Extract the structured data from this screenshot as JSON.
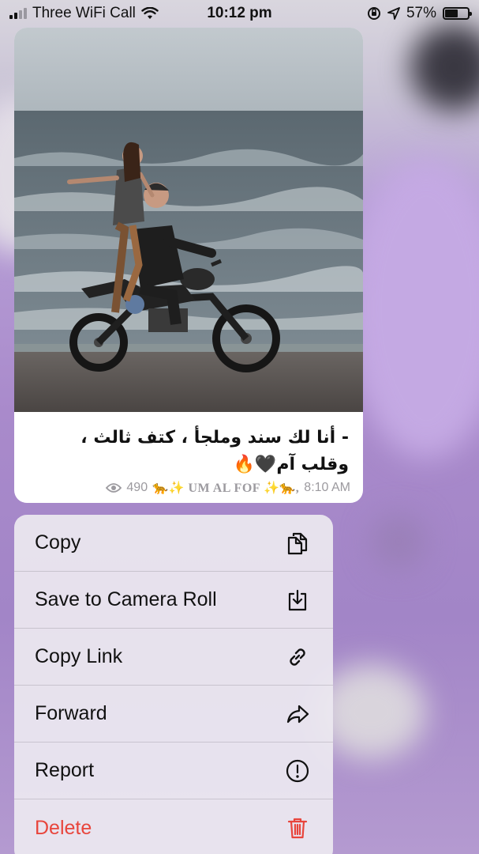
{
  "status_bar": {
    "carrier": "Three WiFi Call",
    "time": "10:12 pm",
    "battery_percent": "57%",
    "battery_level": 0.57,
    "signal_bars": 2
  },
  "message": {
    "caption_line1": "- أنا لك سند وملجأ ، كتف ثالث ،",
    "caption_line2": "وقلب آم🖤🔥",
    "views": "490",
    "channel_name": "🐆✨ UM AL FOF ✨🐆,",
    "time": "8:10 AM",
    "photo_icon": "couple-on-motorcycle-photo"
  },
  "menu": {
    "items": [
      {
        "label": "Copy",
        "icon": "copy-icon"
      },
      {
        "label": "Save to Camera Roll",
        "icon": "save-download-icon"
      },
      {
        "label": "Copy Link",
        "icon": "link-icon"
      },
      {
        "label": "Forward",
        "icon": "forward-arrow-icon"
      },
      {
        "label": "Report",
        "icon": "exclamation-circle-icon"
      },
      {
        "label": "Delete",
        "icon": "trash-icon"
      }
    ]
  },
  "colors": {
    "destructive": "#e8453c",
    "background_purple": "#a98acb",
    "meta_gray": "#9c9a9f"
  }
}
